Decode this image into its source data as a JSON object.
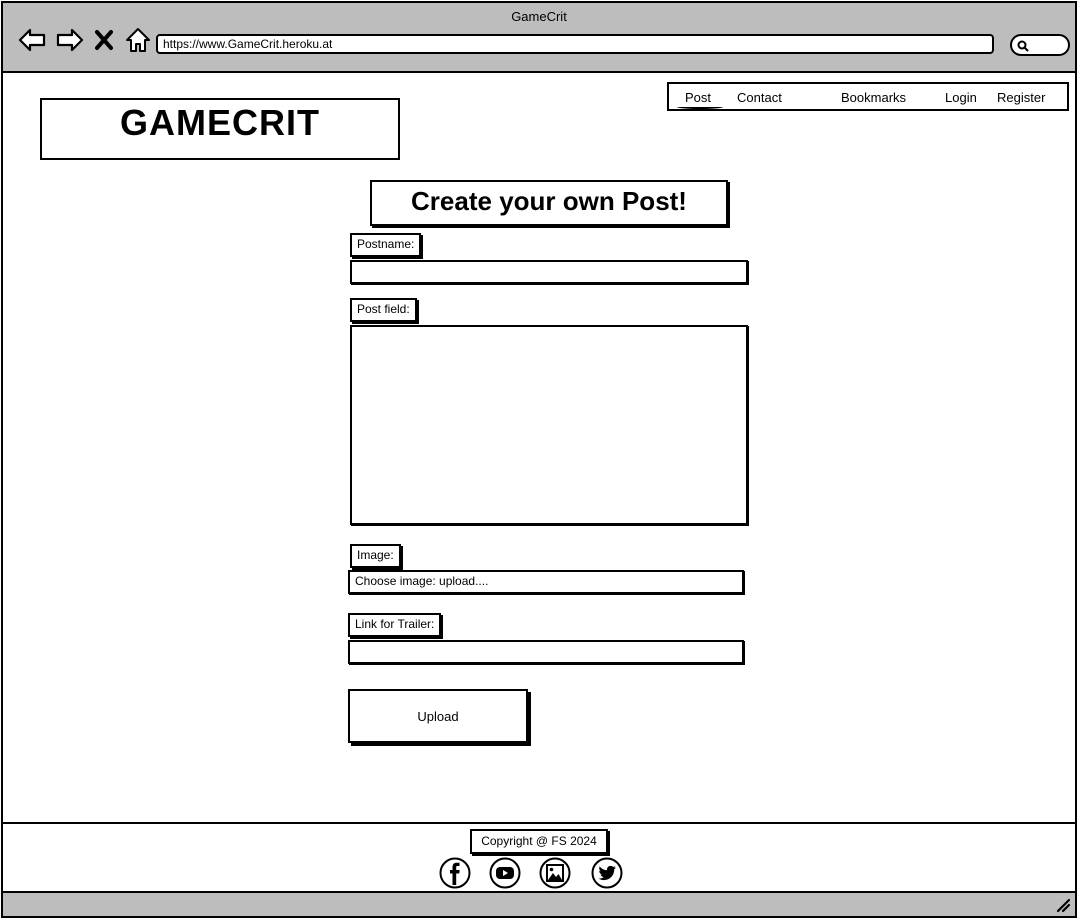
{
  "window": {
    "title": "GameCrit"
  },
  "browser": {
    "url": "https://www.GameCrit.heroku.at",
    "icons": [
      "back-arrow-icon",
      "forward-arrow-icon",
      "close-icon",
      "home-icon",
      "search-icon"
    ]
  },
  "site": {
    "logo": "GAMECRIT"
  },
  "nav": {
    "post": "Post",
    "contact": "Contact",
    "bookmarks": "Bookmarks",
    "login": "Login",
    "register": "Register"
  },
  "form": {
    "heading": "Create your own Post!",
    "postname_label": "Postname:",
    "postfield_label": "Post field:",
    "image_label": "Image:",
    "image_value": "Choose image: upload....",
    "trailer_label": "Link for Trailer:",
    "upload_button": "Upload"
  },
  "footer": {
    "copyright": "Copyright @ FS 2024",
    "social_icons": [
      "facebook-icon",
      "youtube-icon",
      "image-icon",
      "twitter-icon"
    ]
  }
}
